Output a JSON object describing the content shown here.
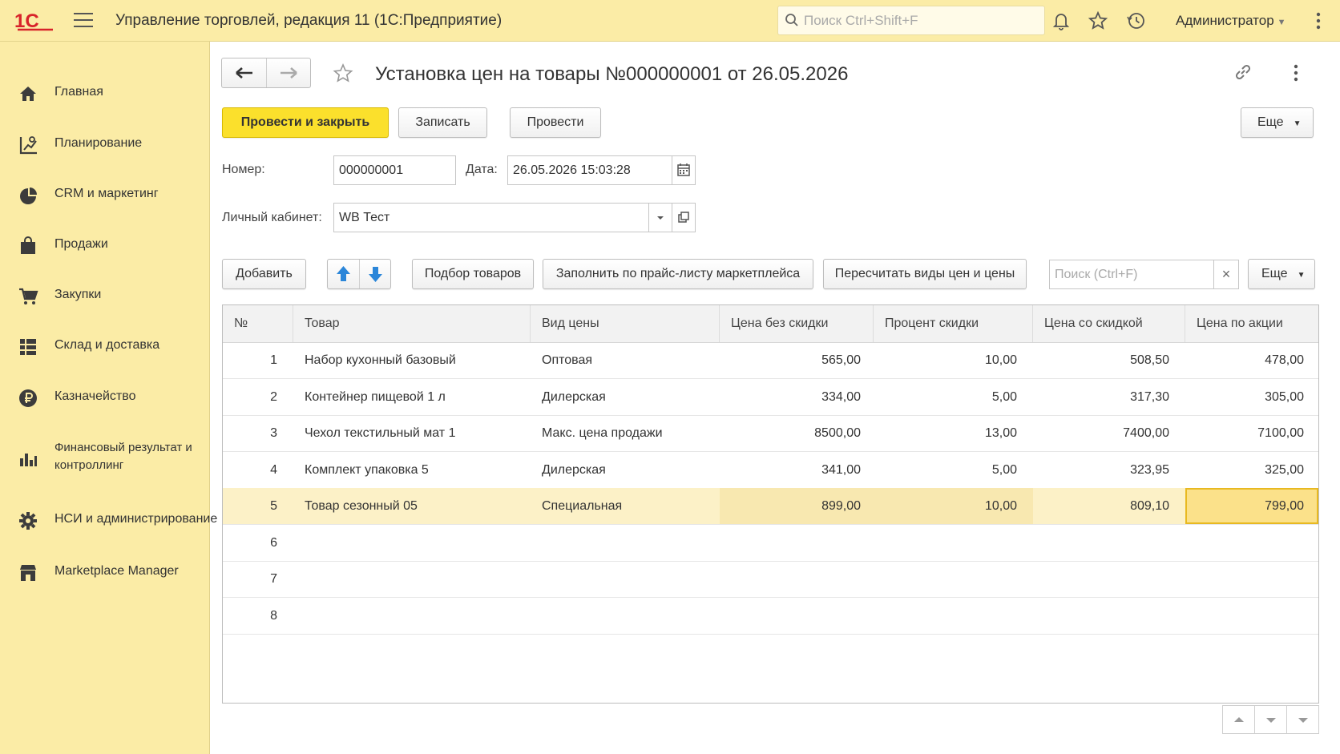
{
  "header": {
    "app_title": "Управление торговлей, редакция 11  (1С:Предприятие)",
    "search_placeholder": "Поиск Ctrl+Shift+F",
    "user_name": "Администратор",
    "logo_text": "1С"
  },
  "sidebar": {
    "items": [
      {
        "label": "Главная",
        "icon": "home-icon"
      },
      {
        "label": "Планирование",
        "icon": "planning-icon"
      },
      {
        "label": "CRM и маркетинг",
        "icon": "pie-chart-icon"
      },
      {
        "label": "Продажи",
        "icon": "shopping-bag-icon"
      },
      {
        "label": "Закупки",
        "icon": "cart-icon"
      },
      {
        "label": "Склад и доставка",
        "icon": "grid-icon"
      },
      {
        "label": "Казначейство",
        "icon": "ruble-icon"
      },
      {
        "label": "Финансовый результат и контроллинг",
        "icon": "bar-chart-icon"
      },
      {
        "label": "НСИ и администрирование",
        "icon": "gear-icon"
      },
      {
        "label": "Marketplace Manager",
        "icon": "store-icon"
      }
    ]
  },
  "document": {
    "title": "Установка цен на товары №000000001 от 26.05.2026",
    "buttons": {
      "post_close": "Провести и закрыть",
      "save": "Записать",
      "post": "Провести",
      "more": "Еще"
    },
    "fields": {
      "number_label": "Номер:",
      "number_value": "000000001",
      "date_label": "Дата:",
      "date_value": "26.05.2026 15:03:28",
      "cabinet_label": "Личный кабинет:",
      "cabinet_value": "WB Тест"
    },
    "table_toolbar": {
      "add": "Добавить",
      "pick": "Подбор товаров",
      "fill": "Заполнить по прайс-листу маркетплейса",
      "recalc": "Пересчитать виды цен и цены",
      "search_placeholder": "Поиск (Ctrl+F)",
      "clear": "×",
      "more": "Еще"
    },
    "table": {
      "columns": [
        "№",
        "Товар",
        "Вид цены",
        "Цена без скидки",
        "Процент скидки",
        "Цена со скидкой",
        "Цена по акции"
      ],
      "rows": [
        {
          "n": "1",
          "product": "Набор кухонный базовый",
          "price_type": "Оптовая",
          "price": "565,00",
          "discount": "10,00",
          "price_disc": "508,50",
          "promo": "478,00"
        },
        {
          "n": "2",
          "product": "Контейнер пищевой 1 л",
          "price_type": "Дилерская",
          "price": "334,00",
          "discount": "5,00",
          "price_disc": "317,30",
          "promo": "305,00"
        },
        {
          "n": "3",
          "product": "Чехол текстильный мат 1",
          "price_type": "Макс. цена продажи",
          "price": "8500,00",
          "discount": "13,00",
          "price_disc": "7400,00",
          "promo": "7100,00"
        },
        {
          "n": "4",
          "product": "Комплект упаковка 5",
          "price_type": "Дилерская",
          "price": "341,00",
          "discount": "5,00",
          "price_disc": "323,95",
          "promo": "325,00"
        },
        {
          "n": "5",
          "product": "Товар сезонный 05",
          "price_type": "Специальная",
          "price": "899,00",
          "discount": "10,00",
          "price_disc": "809,10",
          "promo": "799,00"
        },
        {
          "n": "6",
          "product": "",
          "price_type": "",
          "price": "",
          "discount": "",
          "price_disc": "",
          "promo": ""
        },
        {
          "n": "7",
          "product": "",
          "price_type": "",
          "price": "",
          "discount": "",
          "price_disc": "",
          "promo": ""
        },
        {
          "n": "8",
          "product": "",
          "price_type": "",
          "price": "",
          "discount": "",
          "price_disc": "",
          "promo": ""
        }
      ],
      "selected_row": "5"
    }
  },
  "colors": {
    "panel": "#fbeca6",
    "primary_button": "#fbe02c",
    "selected_row": "#fcf1c7",
    "arrow_blue": "#2b86d9",
    "logo_red": "#d8232a"
  }
}
